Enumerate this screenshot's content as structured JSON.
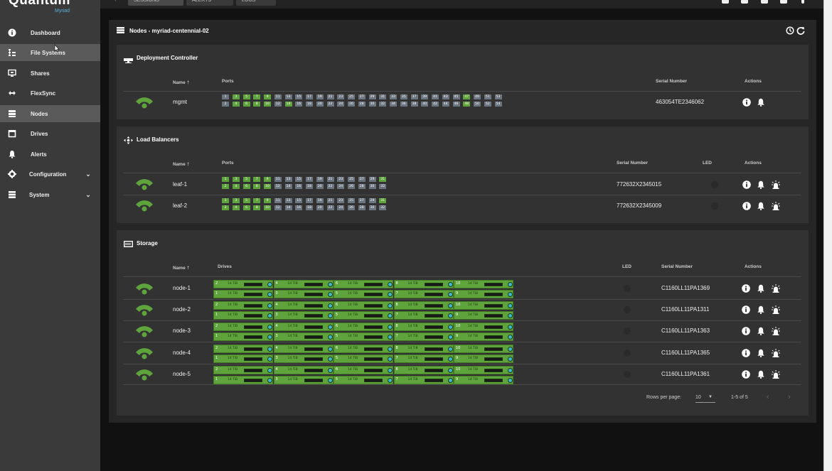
{
  "app": {
    "logo": "Quantum",
    "logo_sub": "Myriad"
  },
  "sidebar": {
    "items": [
      {
        "label": "Dashboard",
        "icon": "info-icon"
      },
      {
        "label": "File Systems",
        "icon": "file-tree-icon"
      },
      {
        "label": "Shares",
        "icon": "monitor-share-icon"
      },
      {
        "label": "FlexSync",
        "icon": "arrows-horizontal-icon"
      },
      {
        "label": "Nodes",
        "icon": "server-icon",
        "active": true
      },
      {
        "label": "Drives",
        "icon": "drive-icon"
      },
      {
        "label": "Alerts",
        "icon": "bell-icon"
      },
      {
        "label": "Configuration",
        "icon": "gear-icon",
        "expandable": true
      },
      {
        "label": "System",
        "icon": "stack-icon",
        "expandable": true
      }
    ]
  },
  "topbar": {
    "tabs": [
      "SESSIONS",
      "ALERTS",
      "LOGS"
    ]
  },
  "page": {
    "title": "Nodes - myriad-centennial-02"
  },
  "deployment": {
    "title": "Deployment Controller",
    "headers": {
      "name": "Name",
      "ports": "Ports",
      "serial": "Serial Number",
      "actions": "Actions"
    },
    "row": {
      "name": "mgmt",
      "serial": "463054TE2346062",
      "ports_top": [
        "1",
        "3",
        "5",
        "7",
        "9",
        "11",
        "13",
        "15",
        "17",
        "19",
        "21",
        "23",
        "25",
        "27",
        "29",
        "31",
        "33",
        "35",
        "37",
        "39",
        "41",
        "43",
        "45",
        "47",
        "49",
        "51",
        "53"
      ],
      "ports_bottom": [
        "2",
        "4",
        "6",
        "8",
        "10",
        "12",
        "14",
        "16",
        "18",
        "20",
        "22",
        "24",
        "26",
        "28",
        "30",
        "32",
        "34",
        "36",
        "38",
        "40",
        "42",
        "44",
        "46",
        "48",
        "50",
        "52",
        "54"
      ],
      "on_top": [
        "3",
        "5",
        "7",
        "9",
        "47"
      ],
      "on_bottom": [
        "4",
        "6",
        "8",
        "10",
        "14",
        "48"
      ]
    }
  },
  "load_balancers": {
    "title": "Load Balancers",
    "headers": {
      "name": "Name",
      "ports": "Ports",
      "serial": "Serial Number",
      "led": "LED",
      "actions": "Actions"
    },
    "ports_top": [
      "1",
      "3",
      "5",
      "7",
      "9",
      "11",
      "13",
      "15",
      "17",
      "19",
      "21",
      "23",
      "25",
      "27",
      "29",
      "31"
    ],
    "ports_bottom": [
      "2",
      "4",
      "6",
      "8",
      "10",
      "12",
      "14",
      "16",
      "18",
      "20",
      "22",
      "24",
      "26",
      "28",
      "30",
      "32"
    ],
    "on_top": [
      "1",
      "3",
      "5",
      "7",
      "9",
      "31"
    ],
    "on_bottom": [
      "2",
      "4",
      "6",
      "8",
      "10"
    ],
    "rows": [
      {
        "name": "leaf-1",
        "serial": "772632X2345015"
      },
      {
        "name": "leaf-2",
        "serial": "772632X2345009"
      }
    ]
  },
  "storage": {
    "title": "Storage",
    "headers": {
      "name": "Name",
      "drives": "Drives",
      "led": "LED",
      "serial": "Serial Number",
      "actions": "Actions"
    },
    "drive_size": "14 TiB",
    "slots_top": [
      "2",
      "4",
      "6",
      "8",
      "10"
    ],
    "slots_bottom": [
      "1",
      "3",
      "5",
      "7",
      "9"
    ],
    "rows": [
      {
        "name": "node-1",
        "serial": "C1160LL11PA1369"
      },
      {
        "name": "node-2",
        "serial": "C1160LL11PA1311"
      },
      {
        "name": "node-3",
        "serial": "C1160LL11PA1363"
      },
      {
        "name": "node-4",
        "serial": "C1160LL11PA1365"
      },
      {
        "name": "node-5",
        "serial": "C1160LL11PA1361"
      }
    ],
    "pagination": {
      "rows_per_page_label": "Rows per page:",
      "rows_per_page": "10",
      "range": "1-5 of 5"
    }
  },
  "colors": {
    "port_on": "#5fa33c",
    "port_off": "#6b7580",
    "status_green": "#5fa33c"
  }
}
